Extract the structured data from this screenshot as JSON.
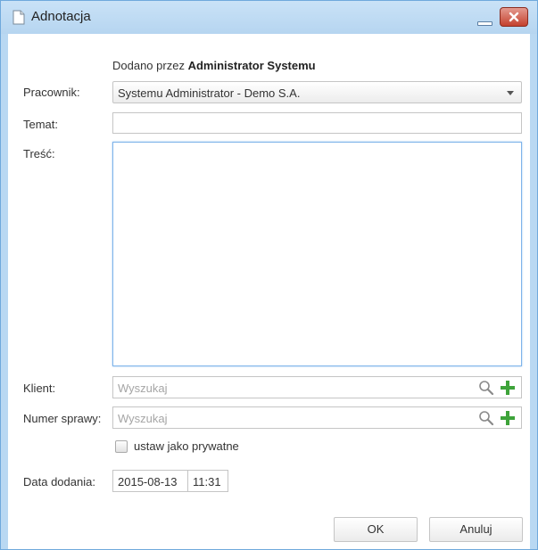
{
  "window": {
    "title": "Adnotacja"
  },
  "form": {
    "added_by_prefix": "Dodano przez",
    "added_by_name": "Administrator Systemu",
    "employee": {
      "label": "Pracownik:",
      "value": "Systemu Administrator - Demo S.A."
    },
    "subject": {
      "label": "Temat:",
      "value": ""
    },
    "content": {
      "label": "Treść:",
      "value": ""
    },
    "client": {
      "label": "Klient:",
      "placeholder": "Wyszukaj"
    },
    "case_number": {
      "label": "Numer sprawy:",
      "placeholder": "Wyszukaj"
    },
    "private": {
      "label": "ustaw jako prywatne",
      "checked": false
    },
    "date_added": {
      "label": "Data dodania:",
      "date": "2015-08-13",
      "time": "11:31"
    }
  },
  "buttons": {
    "ok": "OK",
    "cancel": "Anuluj"
  },
  "icons": {
    "window": "document-icon",
    "minimize": "minimize-icon",
    "close": "close-icon",
    "search": "magnifier-icon",
    "add": "plus-icon",
    "dropdown": "chevron-down-icon"
  },
  "colors": {
    "titlebar": "#b9d8f2",
    "close": "#c9483a",
    "add": "#3ea33a",
    "focus_border": "#7eb4ea"
  }
}
